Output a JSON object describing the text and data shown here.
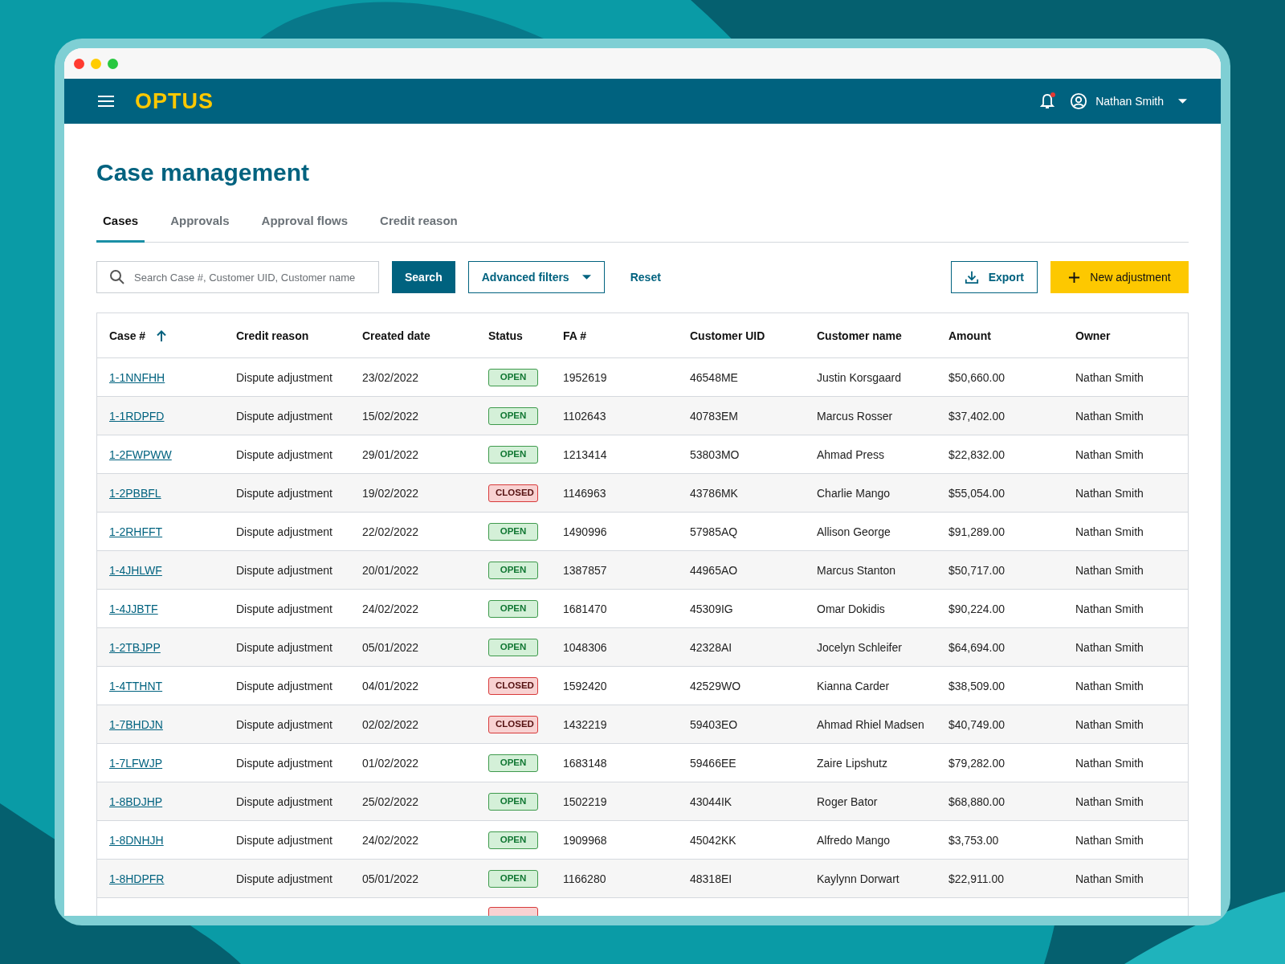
{
  "header": {
    "logo": "OPTUS",
    "notifications": {
      "unread": true
    },
    "user": "Nathan Smith"
  },
  "page": {
    "title": "Case management"
  },
  "tabs": [
    {
      "label": "Cases",
      "selected": true
    },
    {
      "label": "Approvals",
      "selected": false
    },
    {
      "label": "Approval flows",
      "selected": false
    },
    {
      "label": "Credit reason",
      "selected": false
    }
  ],
  "toolbar": {
    "search": {
      "placeholder": "Search Case #, Customer UID, Customer name"
    },
    "search_button": "Search",
    "filters_button": "Advanced filters",
    "reset_link": "Reset",
    "export_button": "Export",
    "new_button": "New adjustment"
  },
  "table": {
    "columns": [
      {
        "label": "Case #",
        "sorted": true
      },
      {
        "label": "Credit reason"
      },
      {
        "label": "Created date"
      },
      {
        "label": "Status"
      },
      {
        "label": "FA #"
      },
      {
        "label": "Customer UID"
      },
      {
        "label": "Customer name"
      },
      {
        "label": "Amount"
      },
      {
        "label": "Owner"
      }
    ],
    "rows": [
      {
        "case": "1-1NNFHH",
        "reason": "Dispute adjustment",
        "date": "23/02/2022",
        "status": {
          "label": "OPEN",
          "kind": "open"
        },
        "fa": "1952619",
        "uid": "46548ME",
        "name": "Justin Korsgaard",
        "amount": "$50,660.00",
        "owner": "Nathan Smith"
      },
      {
        "case": "1-1RDPFD",
        "reason": "Dispute adjustment",
        "date": "15/02/2022",
        "status": {
          "label": "OPEN",
          "kind": "open"
        },
        "fa": "1102643",
        "uid": "40783EM",
        "name": "Marcus Rosser",
        "amount": "$37,402.00",
        "owner": "Nathan Smith"
      },
      {
        "case": "1-2FWPWW",
        "reason": "Dispute adjustment",
        "date": "29/01/2022",
        "status": {
          "label": "OPEN",
          "kind": "open"
        },
        "fa": "1213414",
        "uid": "53803MO",
        "name": "Ahmad Press",
        "amount": "$22,832.00",
        "owner": "Nathan Smith"
      },
      {
        "case": "1-2PBBFL",
        "reason": "Dispute adjustment",
        "date": "19/02/2022",
        "status": {
          "label": "CLOSED",
          "kind": "closed"
        },
        "fa": "1146963",
        "uid": "43786MK",
        "name": "Charlie Mango",
        "amount": "$55,054.00",
        "owner": "Nathan Smith"
      },
      {
        "case": "1-2RHFFT",
        "reason": "Dispute adjustment",
        "date": "22/02/2022",
        "status": {
          "label": "OPEN",
          "kind": "open"
        },
        "fa": "1490996",
        "uid": "57985AQ",
        "name": "Allison George",
        "amount": "$91,289.00",
        "owner": "Nathan Smith"
      },
      {
        "case": "1-4JHLWF",
        "reason": "Dispute adjustment",
        "date": "20/01/2022",
        "status": {
          "label": "OPEN",
          "kind": "open"
        },
        "fa": "1387857",
        "uid": "44965AO",
        "name": "Marcus Stanton",
        "amount": "$50,717.00",
        "owner": "Nathan Smith"
      },
      {
        "case": "1-4JJBTF",
        "reason": "Dispute adjustment",
        "date": "24/02/2022",
        "status": {
          "label": "OPEN",
          "kind": "open"
        },
        "fa": "1681470",
        "uid": "45309IG",
        "name": "Omar Dokidis",
        "amount": "$90,224.00",
        "owner": "Nathan Smith"
      },
      {
        "case": "1-2TBJPP",
        "reason": "Dispute adjustment",
        "date": "05/01/2022",
        "status": {
          "label": "OPEN",
          "kind": "open"
        },
        "fa": "1048306",
        "uid": "42328AI",
        "name": "Jocelyn Schleifer",
        "amount": "$64,694.00",
        "owner": "Nathan Smith"
      },
      {
        "case": "1-4TTHNT",
        "reason": "Dispute adjustment",
        "date": "04/01/2022",
        "status": {
          "label": "CLOSED",
          "kind": "closed"
        },
        "fa": "1592420",
        "uid": "42529WO",
        "name": "Kianna Carder",
        "amount": "$38,509.00",
        "owner": "Nathan Smith"
      },
      {
        "case": "1-7BHDJN",
        "reason": "Dispute adjustment",
        "date": "02/02/2022",
        "status": {
          "label": "CLOSED",
          "kind": "closed"
        },
        "fa": "1432219",
        "uid": "59403EO",
        "name": "Ahmad Rhiel Madsen",
        "amount": "$40,749.00",
        "owner": "Nathan Smith"
      },
      {
        "case": "1-7LFWJP",
        "reason": "Dispute adjustment",
        "date": "01/02/2022",
        "status": {
          "label": "OPEN",
          "kind": "open"
        },
        "fa": "1683148",
        "uid": "59466EE",
        "name": "Zaire Lipshutz",
        "amount": "$79,282.00",
        "owner": "Nathan Smith"
      },
      {
        "case": "1-8BDJHP",
        "reason": "Dispute adjustment",
        "date": "25/02/2022",
        "status": {
          "label": "OPEN",
          "kind": "open"
        },
        "fa": "1502219",
        "uid": "43044IK",
        "name": "Roger Bator",
        "amount": "$68,880.00",
        "owner": "Nathan Smith"
      },
      {
        "case": "1-8DNHJH",
        "reason": "Dispute adjustment",
        "date": "24/02/2022",
        "status": {
          "label": "OPEN",
          "kind": "open"
        },
        "fa": "1909968",
        "uid": "45042KK",
        "name": "Alfredo Mango",
        "amount": "$3,753.00",
        "owner": "Nathan Smith"
      },
      {
        "case": "1-8HDPFR",
        "reason": "Dispute adjustment",
        "date": "05/01/2022",
        "status": {
          "label": "OPEN",
          "kind": "open"
        },
        "fa": "1166280",
        "uid": "48318EI",
        "name": "Kaylynn Dorwart",
        "amount": "$22,911.00",
        "owner": "Nathan Smith"
      },
      {
        "status": {
          "kind": "closed"
        }
      }
    ]
  }
}
